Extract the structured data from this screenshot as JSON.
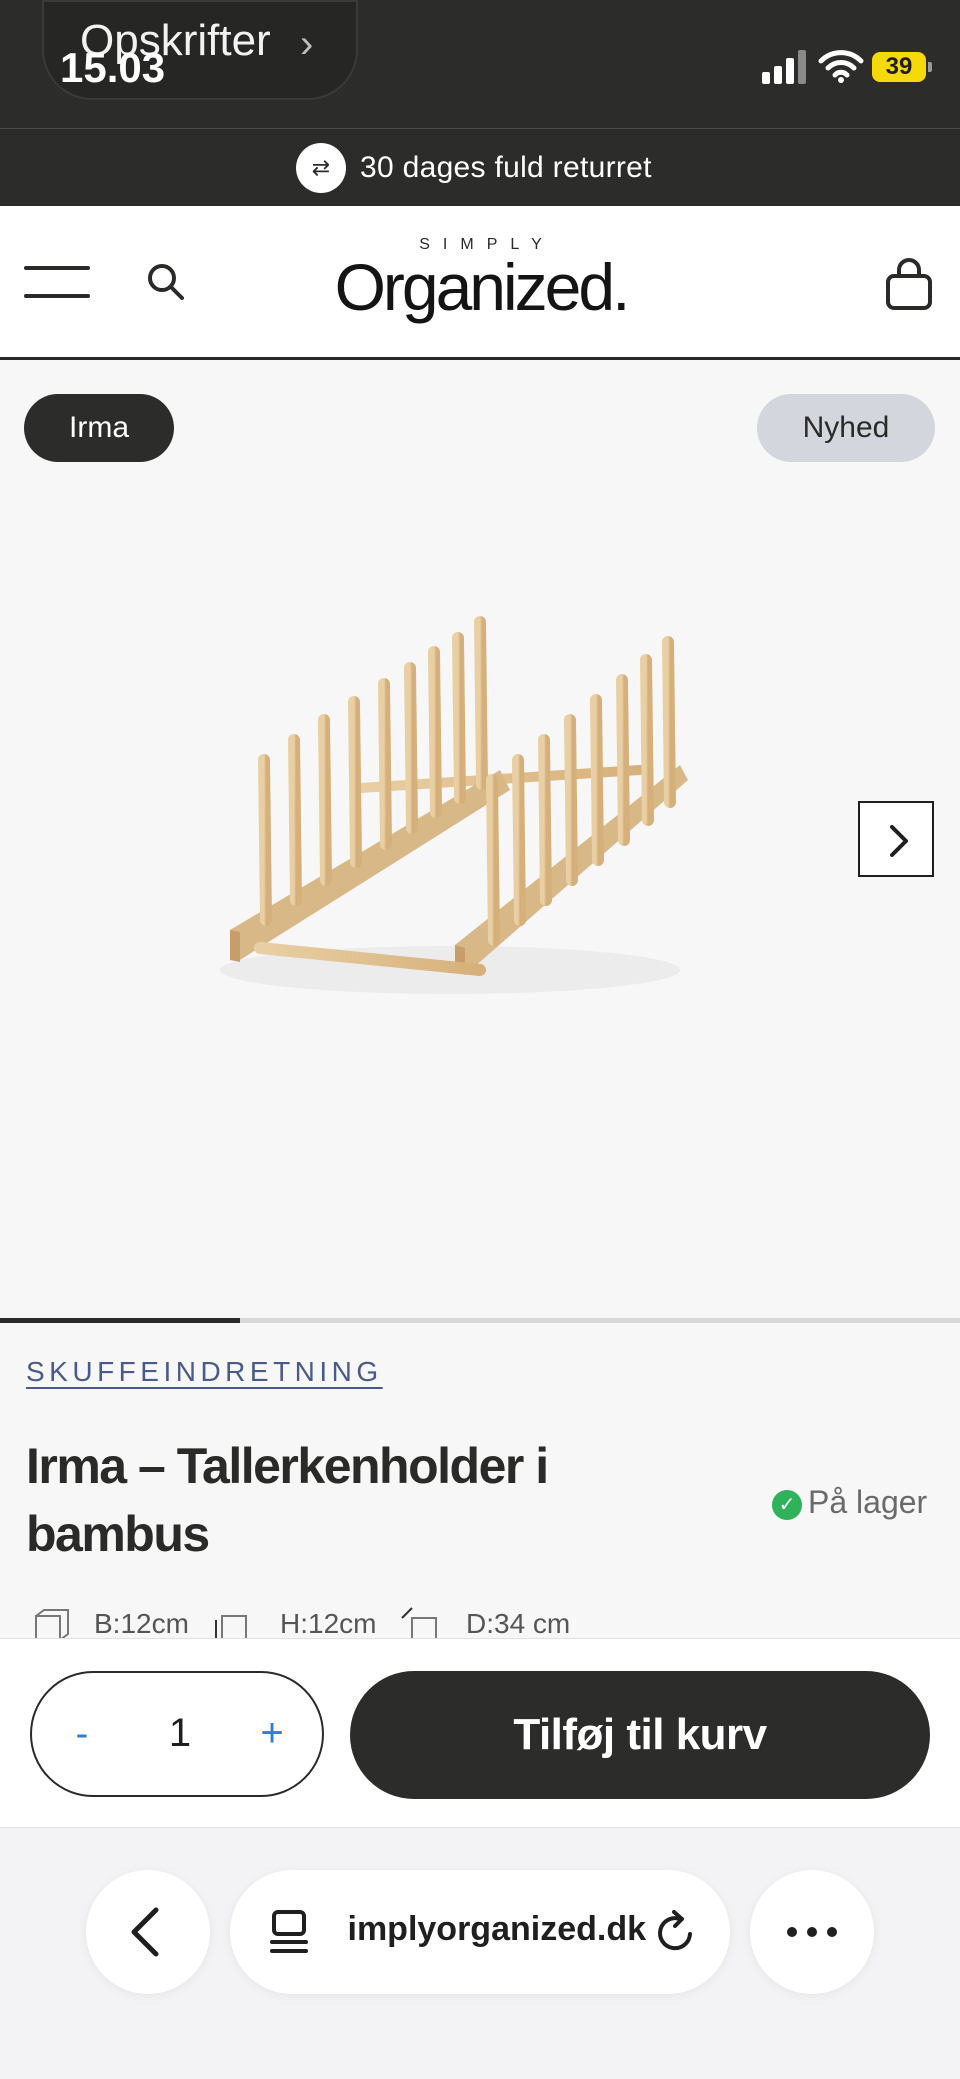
{
  "status_bar": {
    "back_app_label": "Opskrifter",
    "time": "15.03",
    "battery": "39"
  },
  "promo": {
    "text": "30 dages fuld returret",
    "icon": "return-arrows-icon"
  },
  "header": {
    "logo_small": "SIMPLY",
    "logo_big": "Organized.",
    "icons": [
      "menu-icon",
      "search-icon",
      "shopping-bag-icon"
    ]
  },
  "gallery": {
    "brand_tag": "Irma",
    "new_tag": "Nyhed",
    "slide_progress_fraction": 0.25
  },
  "product": {
    "category": "SKUFFEINDRETNING",
    "title": "Irma – Tallerkenholder i bambus",
    "stock": "På lager",
    "dimensions": [
      "B:12cm",
      "H:12cm",
      "D:34 cm"
    ]
  },
  "buy": {
    "quantity": "1",
    "minus_label": "-",
    "plus_label": "+",
    "add_to_cart": "Tilføj til kurv"
  },
  "browser": {
    "url": "simplyorganized.dk"
  },
  "colors": {
    "dark": "#2c2d2b",
    "accent_blue": "#2f7ed8",
    "stock_green": "#2fb25a",
    "category_link": "#4a5a8a"
  }
}
